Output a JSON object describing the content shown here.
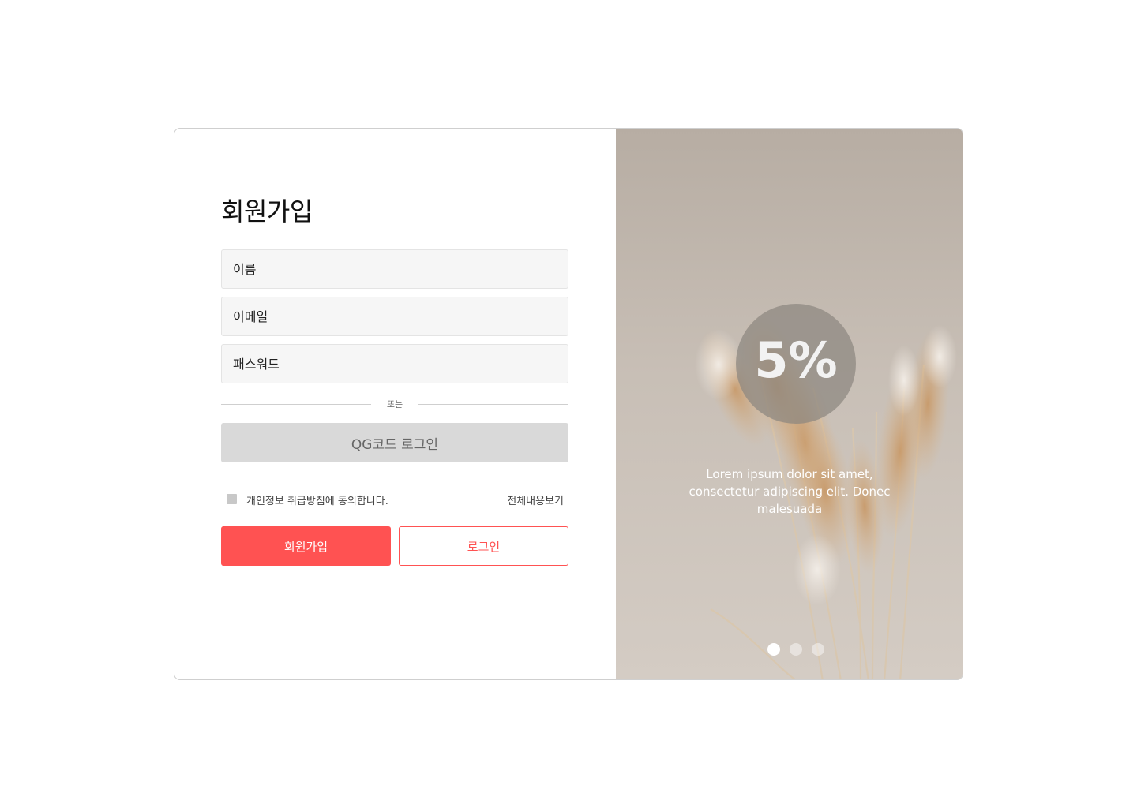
{
  "signup": {
    "title": "회원가입",
    "fields": [
      {
        "placeholder": "이름"
      },
      {
        "placeholder": "이메일"
      },
      {
        "placeholder": "패스워드"
      }
    ],
    "divider_text": "또는",
    "qr_button_label": "QG코드 로그인",
    "agree_text": "개인정보 취급방침에 동의합니다.",
    "agree_checked": false,
    "view_all_link": "전체내용보기",
    "signup_button_label": "회원가입",
    "login_button_label": "로그인"
  },
  "promo": {
    "badge_text": "5%",
    "caption": "Lorem ipsum dolor sit amet, consectetur adipiscing elit. Donec malesuada",
    "slides_total": 3,
    "active_slide": 1
  },
  "colors": {
    "accent": "#ff5252",
    "field_bg": "#f6f6f6",
    "qr_button_bg": "#d9d9d9",
    "badge_bg": "#8c8680"
  }
}
